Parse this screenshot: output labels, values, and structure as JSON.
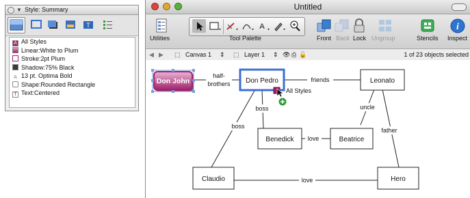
{
  "panel": {
    "title": "Style: Summary",
    "style_items": [
      {
        "label": "All Styles",
        "swatch": "A",
        "swatch_bg": "#a0206a"
      },
      {
        "label": "Linear:White to Plum",
        "swatch": "",
        "swatch_bg": "#b46a9a"
      },
      {
        "label": "Stroke:2pt Plum",
        "swatch": "",
        "swatch_bg": "#ffffff"
      },
      {
        "label": "Shadow:75% Black",
        "swatch": "",
        "swatch_bg": "#3a3a3a"
      },
      {
        "label": "13 pt. Optima Bold",
        "swatch": "A",
        "swatch_bg": "transparent"
      },
      {
        "label": "Shape:Rounded Rectangle",
        "swatch": "",
        "swatch_bg": "#ffffff"
      },
      {
        "label": "Text:Centered",
        "swatch": "T",
        "swatch_bg": "#ffffff"
      }
    ]
  },
  "window": {
    "title": "Untitled",
    "toolbar": {
      "utilities": "Utilities",
      "tool_palette": "Tool Palette",
      "front": "Front",
      "back": "Back",
      "lock": "Lock",
      "ungroup": "Ungroup",
      "stencils": "Stencils",
      "inspect": "Inspect"
    },
    "layerbar": {
      "canvas": "Canvas 1",
      "layer": "Layer 1",
      "status": "1 of 23 objects selected"
    }
  },
  "diagram": {
    "nodes": {
      "don_john": "Don John",
      "don_pedro": "Don Pedro",
      "leonato": "Leonato",
      "benedick": "Benedick",
      "beatrice": "Beatrice",
      "claudio": "Claudio",
      "hero": "Hero"
    },
    "edges": {
      "half_brothers_1": "half-",
      "half_brothers_2": "brothers",
      "friends": "friends",
      "uncle": "uncle",
      "boss_1": "boss",
      "boss_2": "boss",
      "love_1": "love",
      "love_2": "love",
      "father": "father"
    },
    "drop_tooltip": "All Styles"
  },
  "colors": {
    "plum": "#a0206a",
    "selection": "#3b6fd4",
    "close": "#e0443e",
    "minimize": "#e3a634",
    "zoom": "#57b13c"
  }
}
